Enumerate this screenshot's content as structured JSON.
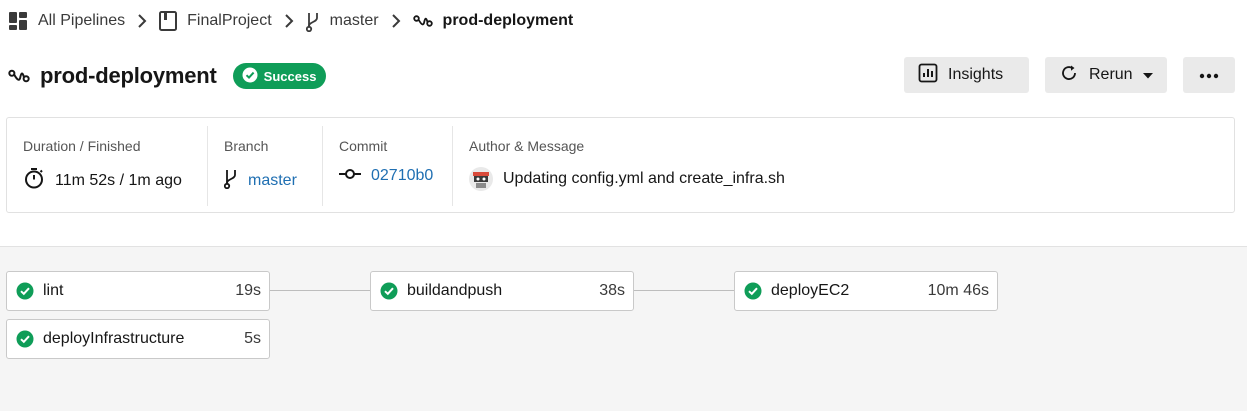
{
  "breadcrumb": {
    "all_pipelines": "All Pipelines",
    "project": "FinalProject",
    "branch": "master",
    "workflow": "prod-deployment"
  },
  "header": {
    "title": "prod-deployment",
    "status": "Success",
    "insights_label": "Insights",
    "rerun_label": "Rerun"
  },
  "summary": {
    "duration_label": "Duration / Finished",
    "duration_value": "11m 52s / 1m ago",
    "branch_label": "Branch",
    "branch_value": "master",
    "commit_label": "Commit",
    "commit_value": "02710b0",
    "author_label": "Author & Message",
    "message": "Updating config.yml and create_infra.sh"
  },
  "jobs": [
    {
      "name": "lint",
      "duration": "19s"
    },
    {
      "name": "deployInfrastructure",
      "duration": "5s"
    },
    {
      "name": "buildandpush",
      "duration": "38s"
    },
    {
      "name": "deployEC2",
      "duration": "10m 46s"
    }
  ],
  "colors": {
    "success": "#0f9d58",
    "link": "#1f6fb2",
    "button_bg": "#eaeaea",
    "workflow_bg": "#f5f5f5"
  }
}
